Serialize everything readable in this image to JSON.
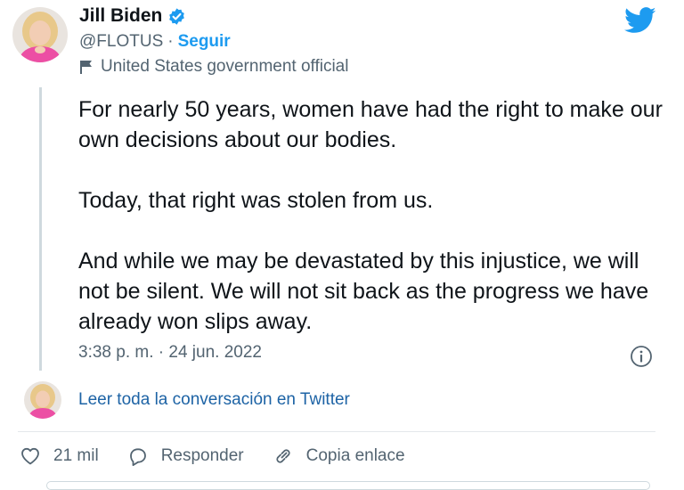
{
  "author": {
    "name": "Jill Biden",
    "handle": "@FLOTUS",
    "separator": "·",
    "follow_label": "Seguir",
    "label": "United States government official"
  },
  "tweet": {
    "paragraphs": [
      "For nearly 50 years, women have had the right to make our own decisions about our bodies.",
      "Today, that right was stolen from us.",
      "And while we may be devastated by this injustice, we will not be silent. We will not sit back as the progress we have already won slips away."
    ],
    "timestamp": "3:38 p. m. · 24 jun. 2022"
  },
  "conversation_link": "Leer toda la conversación en Twitter",
  "actions": {
    "likes": "21 mil",
    "reply": "Responder",
    "copy_link": "Copia enlace"
  },
  "colors": {
    "twitter_blue": "#1d9bf0",
    "link_blue": "#1d63a5",
    "secondary_text": "#536471"
  },
  "icons": [
    "verified-badge-icon",
    "flag-icon",
    "twitter-bird-icon",
    "info-icon",
    "heart-icon",
    "reply-bubble-icon",
    "link-icon"
  ]
}
